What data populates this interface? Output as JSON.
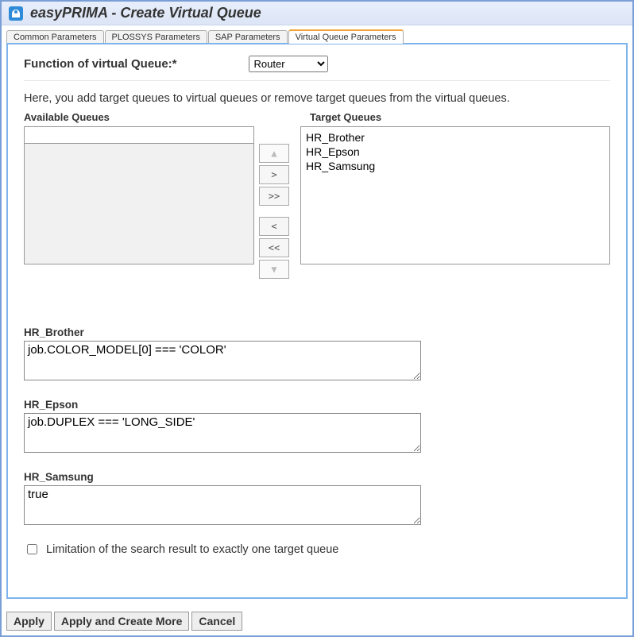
{
  "window": {
    "title": "easyPRIMA - Create Virtual Queue"
  },
  "tabs": [
    {
      "label": "Common Parameters"
    },
    {
      "label": "PLOSSYS Parameters"
    },
    {
      "label": "SAP Parameters"
    },
    {
      "label": "Virtual Queue Parameters",
      "active": true
    }
  ],
  "function_row": {
    "label": "Function of virtual Queue:*",
    "selected": "Router"
  },
  "description": "Here, you add target queues to virtual queues or remove target queues from the virtual queues.",
  "headers": {
    "available": "Available Queues",
    "target": "Target Queues"
  },
  "transfer_buttons": {
    "up": "▲",
    "add_one": ">",
    "add_all": ">>",
    "remove_one": "<",
    "remove_all": "<<",
    "down": "▼"
  },
  "target_queues": [
    "HR_Brother",
    "HR_Epson",
    "HR_Samsung"
  ],
  "rules": [
    {
      "label": "HR_Brother",
      "value": "job.COLOR_MODEL[0] === 'COLOR'"
    },
    {
      "label": "HR_Epson",
      "value": "job.DUPLEX === 'LONG_SIDE'"
    },
    {
      "label": "HR_Samsung",
      "value": "true"
    }
  ],
  "limit_checkbox": {
    "checked": false,
    "label": "Limitation of the search result to exactly one target queue"
  },
  "footer": {
    "apply": "Apply",
    "apply_more": "Apply and Create More",
    "cancel": "Cancel"
  }
}
